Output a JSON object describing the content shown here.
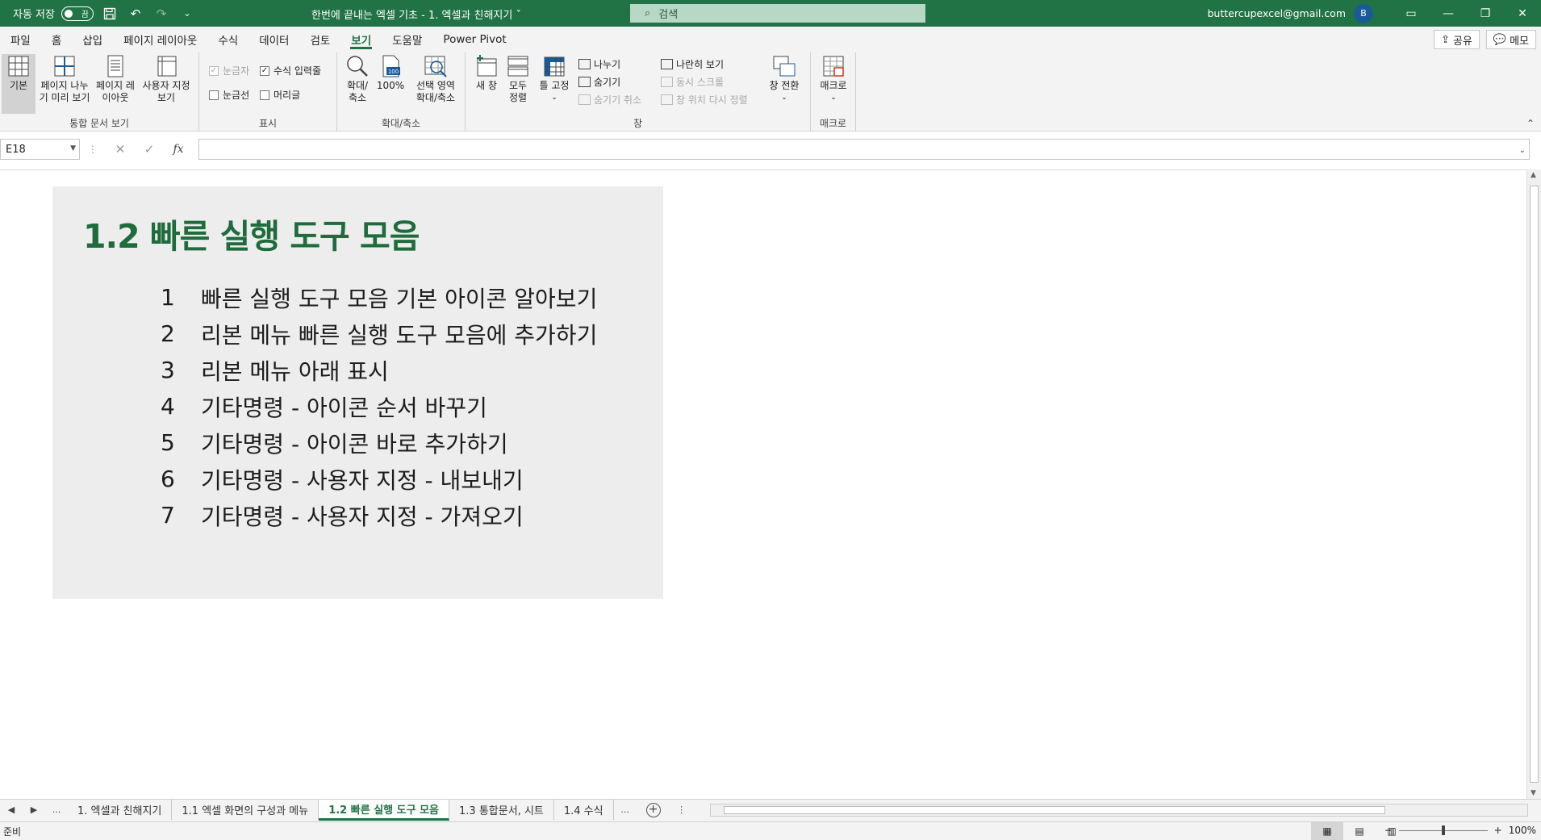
{
  "titlebar": {
    "autosave_label": "자동 저장",
    "autosave_state": "끔",
    "doc_title": "한번에 끝내는 엑셀 기초 - 1. 엑셀과 친해지기 ˇ",
    "search_placeholder": "검색",
    "email": "buttercupexcel@gmail.com",
    "avatar_initial": "B"
  },
  "menu": {
    "tabs": [
      "파일",
      "홈",
      "삽입",
      "페이지 레이아웃",
      "수식",
      "데이터",
      "검토",
      "보기",
      "도움말",
      "Power Pivot"
    ],
    "active_tab": "보기",
    "share_label": "공유",
    "memo_label": "메모"
  },
  "ribbon": {
    "workbook_views": {
      "label": "통합 문서 보기",
      "normal": "기본",
      "page_break": "페이지 나누기 미리 보기",
      "page_layout": "페이지 레이아웃",
      "custom": "사용자 지정 보기"
    },
    "show": {
      "label": "표시",
      "ruler": "눈금자",
      "formula_bar": "수식 입력줄",
      "gridlines": "눈금선",
      "headings": "머리글"
    },
    "zoom": {
      "label": "확대/축소",
      "zoom": "확대/축소",
      "hundred": "100%",
      "zoom_selection": "선택 영역 확대/축소"
    },
    "window": {
      "label": "창",
      "new_window": "새 창",
      "arrange_all": "모두 정렬",
      "freeze": "틀 고정",
      "split": "나누기",
      "hide": "숨기기",
      "unhide": "숨기기 취소",
      "side_by_side": "나란히 보기",
      "sync_scroll": "동시 스크롤",
      "reset_position": "창 위치 다시 정렬",
      "switch_windows": "창 전환"
    },
    "macros": {
      "label": "매크로",
      "macros": "매크로"
    }
  },
  "formula_bar": {
    "name_box": "E18",
    "formula": ""
  },
  "sheet": {
    "heading": "1.2 빠른 실행 도구 모음",
    "items": [
      {
        "num": "1",
        "text": "빠른 실행 도구 모음 기본 아이콘 알아보기"
      },
      {
        "num": "2",
        "text": "리본 메뉴 빠른 실행 도구 모음에 추가하기"
      },
      {
        "num": "3",
        "text": "리본 메뉴 아래 표시"
      },
      {
        "num": "4",
        "text": "기타명령 - 아이콘 순서 바꾸기"
      },
      {
        "num": "5",
        "text": "기타명령 - 아이콘 바로 추가하기"
      },
      {
        "num": "6",
        "text": "기타명령 - 사용자 지정 - 내보내기"
      },
      {
        "num": "7",
        "text": "기타명령 - 사용자 지정 - 가져오기"
      }
    ]
  },
  "sheet_tabs": {
    "ellipsis": "...",
    "tabs": [
      "1. 엑셀과 친해지기",
      "1.1 엑셀 화면의 구성과 메뉴",
      "1.2 빠른 실행 도구 모음",
      "1.3 통합문서, 시트",
      "1.4 수식"
    ],
    "active_tab": "1.2 빠른 실행 도구 모음"
  },
  "statusbar": {
    "status": "준비",
    "zoom": "100%"
  },
  "colors": {
    "brand": "#217346",
    "heading": "#1e6b3c",
    "panel_bg": "#ededed"
  }
}
